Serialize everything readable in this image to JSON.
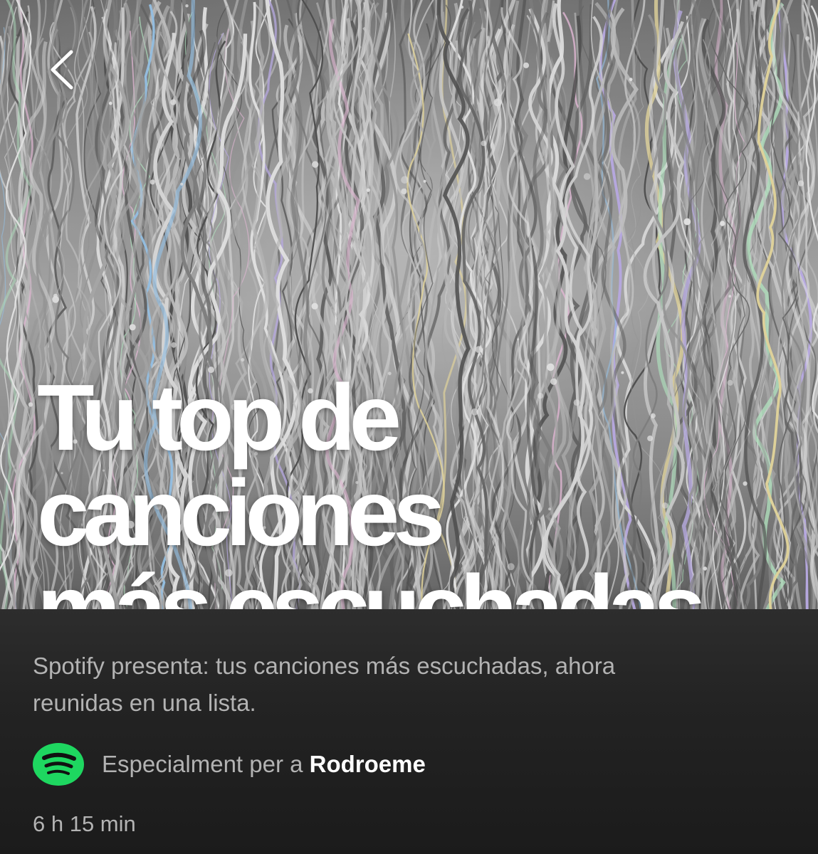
{
  "playlist": {
    "title_line1": "Tu top de canciones",
    "title_line2": "más escuchadas",
    "description_line1": "Spotify presenta: tus canciones más escuchadas, ahora",
    "description_line2": "reunidas en una lista.",
    "owner_prefix": "Especialment per a",
    "owner_name": "Rodroeme",
    "duration": "6 h 15 min"
  },
  "icons": {
    "back": "chevron-left-icon",
    "brand": "spotify-logo-icon"
  },
  "colors": {
    "spotify_green": "#1ed760",
    "background": "#1c1c1c",
    "muted_text": "#b3b3b3",
    "title_text": "#ffffff"
  }
}
